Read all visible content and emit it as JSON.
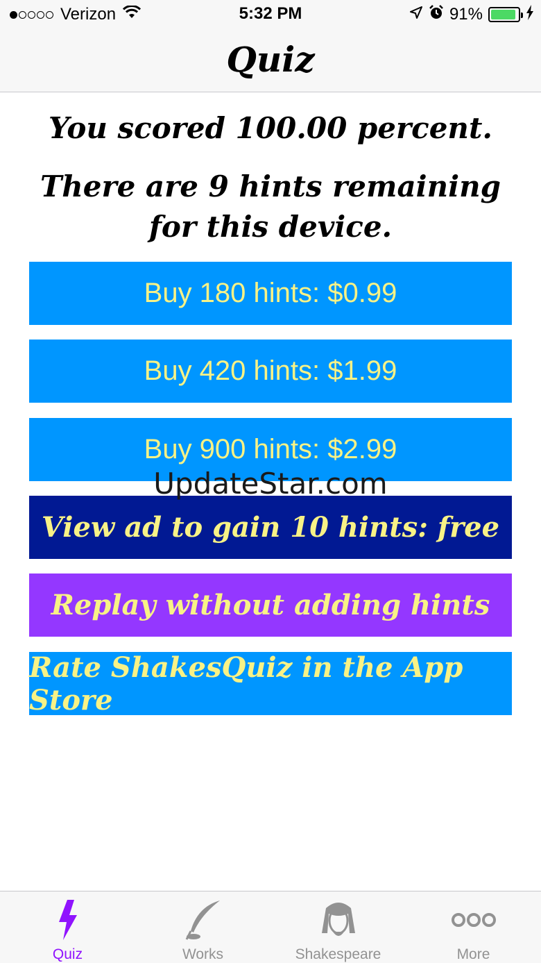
{
  "status_bar": {
    "carrier": "Verizon",
    "time": "5:32 PM",
    "battery_percent": "91%",
    "battery_level": 0.91,
    "signal_bars_filled": 1,
    "signal_bars_total": 5
  },
  "nav": {
    "title": "Quiz"
  },
  "content": {
    "score_text": "You scored 100.00 percent.",
    "hints_text": "There are 9 hints remaining for this device."
  },
  "buttons": {
    "buy_180": "Buy 180 hints: $0.99",
    "buy_420": "Buy 420 hints: $1.99",
    "buy_900": "Buy 900 hints: $2.99",
    "view_ad": "View ad to gain 10 hints: free",
    "replay": "Replay without adding hints",
    "rate": "Rate ShakesQuiz in the App Store"
  },
  "watermark": "UpdateStar.com",
  "tabs": [
    {
      "label": "Quiz",
      "icon": "lightning-icon",
      "active": true
    },
    {
      "label": "Works",
      "icon": "quill-icon",
      "active": false
    },
    {
      "label": "Shakespeare",
      "icon": "shakespeare-portrait-icon",
      "active": false
    },
    {
      "label": "More",
      "icon": "more-icon",
      "active": false
    }
  ],
  "colors": {
    "primary_button": "#0096ff",
    "ad_button": "#011993",
    "replay_button": "#9437ff",
    "button_text": "#f8f286",
    "active_tab": "#9013fe",
    "inactive_tab": "#929292"
  }
}
